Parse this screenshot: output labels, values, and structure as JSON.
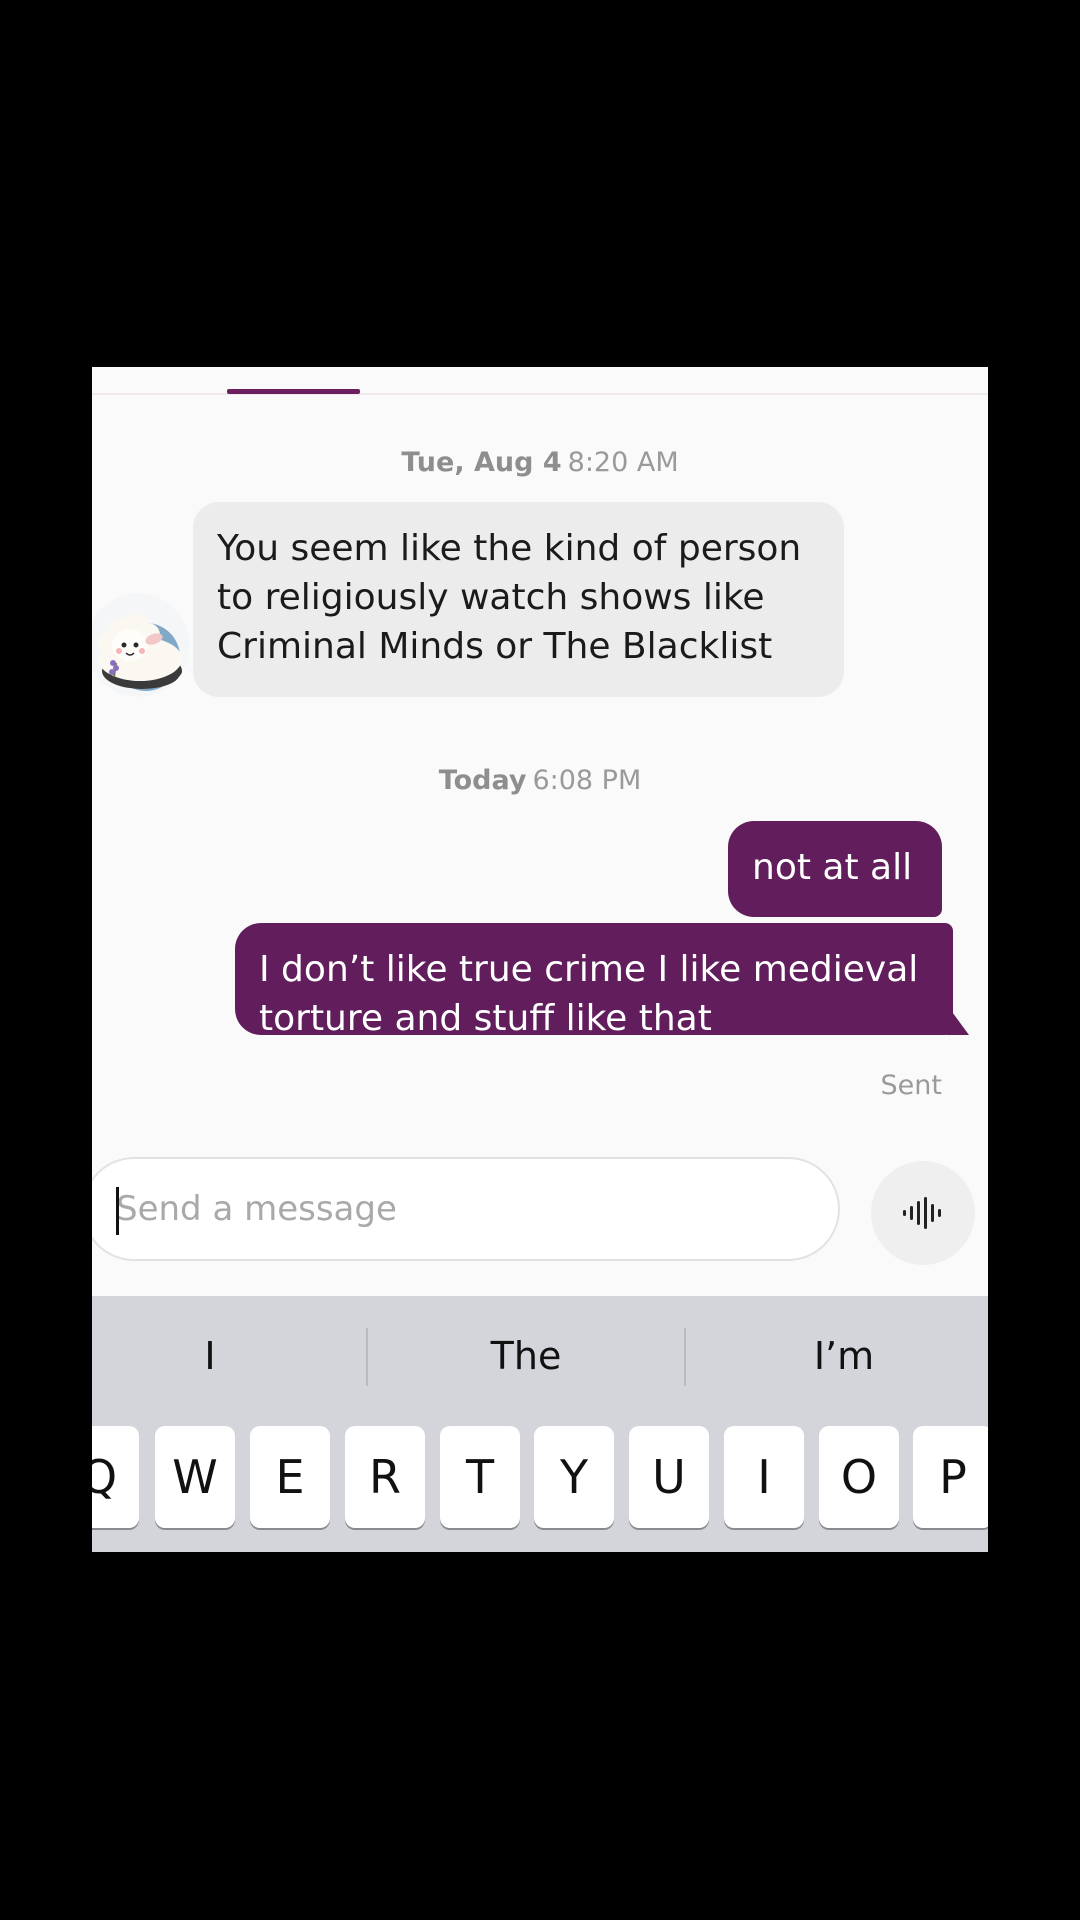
{
  "conversation": {
    "messages": [
      {
        "date_day": "Tue, Aug 4",
        "date_time": "8:20 AM",
        "text": "You seem like the kind of person to religiously watch shows like Criminal Minds or The Blacklist"
      },
      {
        "date_day": "Today",
        "date_time": "6:08 PM",
        "text": "not at all"
      },
      {
        "text": "I don’t like true crime I like medieval torture and stuff like that"
      }
    ],
    "status": "Sent"
  },
  "composer": {
    "placeholder": "Send a message",
    "voice_icon": "voice-waveform-icon"
  },
  "keyboard": {
    "suggestions": [
      "I",
      "The",
      "I’m"
    ],
    "keys": [
      "Q",
      "W",
      "E",
      "R",
      "T",
      "Y",
      "U",
      "I",
      "O",
      "P"
    ]
  },
  "colors": {
    "accent": "#621e5c",
    "received_bubble": "#ececed",
    "keyboard_bg": "#d3d5da"
  }
}
